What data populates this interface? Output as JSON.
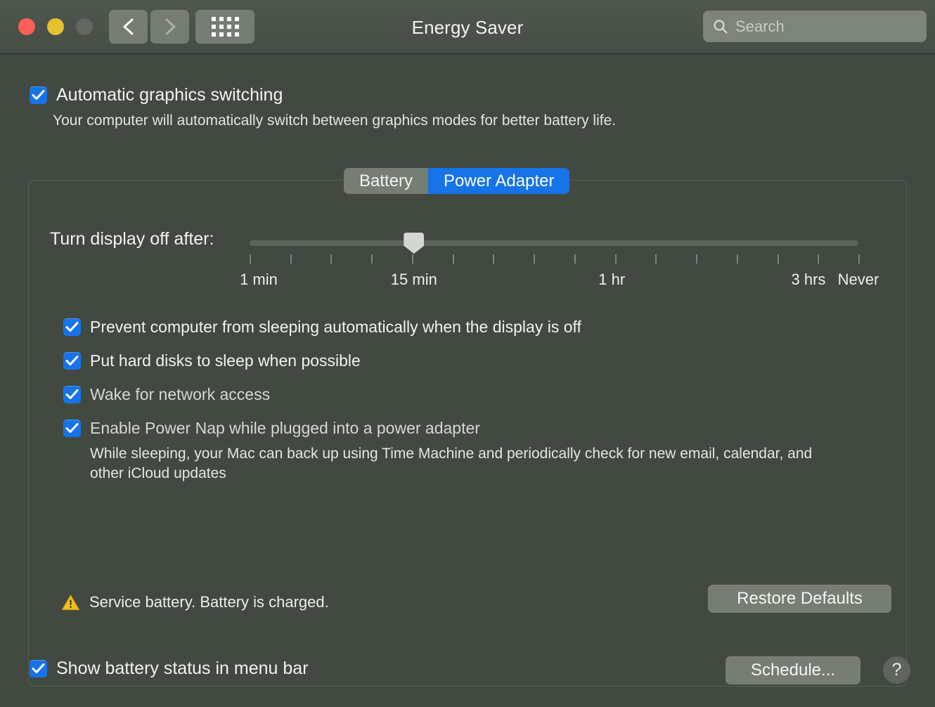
{
  "window": {
    "title": "Energy Saver",
    "traffic_lights": {
      "close_color": "#fc5f57",
      "minimize_color": "#e6c02e",
      "zoom_color": "#62685f"
    },
    "nav": {
      "back_icon": "chevron-left-icon",
      "forward_icon": "chevron-right-icon",
      "show_all_icon": "grid-icon"
    }
  },
  "search": {
    "placeholder": "Search",
    "value": "",
    "icon": "search-icon"
  },
  "automatic_graphics": {
    "label": "Automatic graphics switching",
    "checked": true,
    "description": "Your computer will automatically switch between graphics modes for better battery life."
  },
  "tabs": {
    "items": [
      {
        "label": "Battery",
        "active": false
      },
      {
        "label": "Power Adapter",
        "active": true
      }
    ],
    "active_color": "#1773e8",
    "inactive_color": "#767d73"
  },
  "display_sleep": {
    "label": "Turn display off after:",
    "value": "15 min",
    "thumb_position_percent": 27,
    "tick_count": 16,
    "tick_labels": [
      {
        "text": "1 min",
        "position_percent": 1.5
      },
      {
        "text": "15 min",
        "position_percent": 27
      },
      {
        "text": "1 hr",
        "position_percent": 59.5
      },
      {
        "text": "3 hrs",
        "position_percent": 91.8
      },
      {
        "text": "Never",
        "position_percent": 100
      }
    ]
  },
  "options": [
    {
      "label": "Prevent computer from sleeping automatically when the display is off",
      "checked": true,
      "dim": false
    },
    {
      "label": "Put hard disks to sleep when possible",
      "checked": true,
      "dim": false
    },
    {
      "label": "Wake for network access",
      "checked": true,
      "dim": true
    },
    {
      "label": "Enable Power Nap while plugged into a power adapter",
      "checked": true,
      "dim": true,
      "description": "While sleeping, your Mac can back up using Time Machine and periodically check for new email, calendar, and other iCloud updates"
    }
  ],
  "status": {
    "icon": "warning-triangle-icon",
    "icon_color": "#f0c020",
    "text": "Service battery. Battery is charged."
  },
  "buttons": {
    "restore_defaults": "Restore Defaults",
    "schedule": "Schedule...",
    "help": "?"
  },
  "menu_bar_option": {
    "label": "Show battery status in menu bar",
    "checked": true
  },
  "colors": {
    "window_background": "#414941",
    "toolbar_background": "#4a524a",
    "accent_blue": "#1773e8",
    "text_primary": "#f1f3f0",
    "warning_yellow": "#f0c020"
  }
}
